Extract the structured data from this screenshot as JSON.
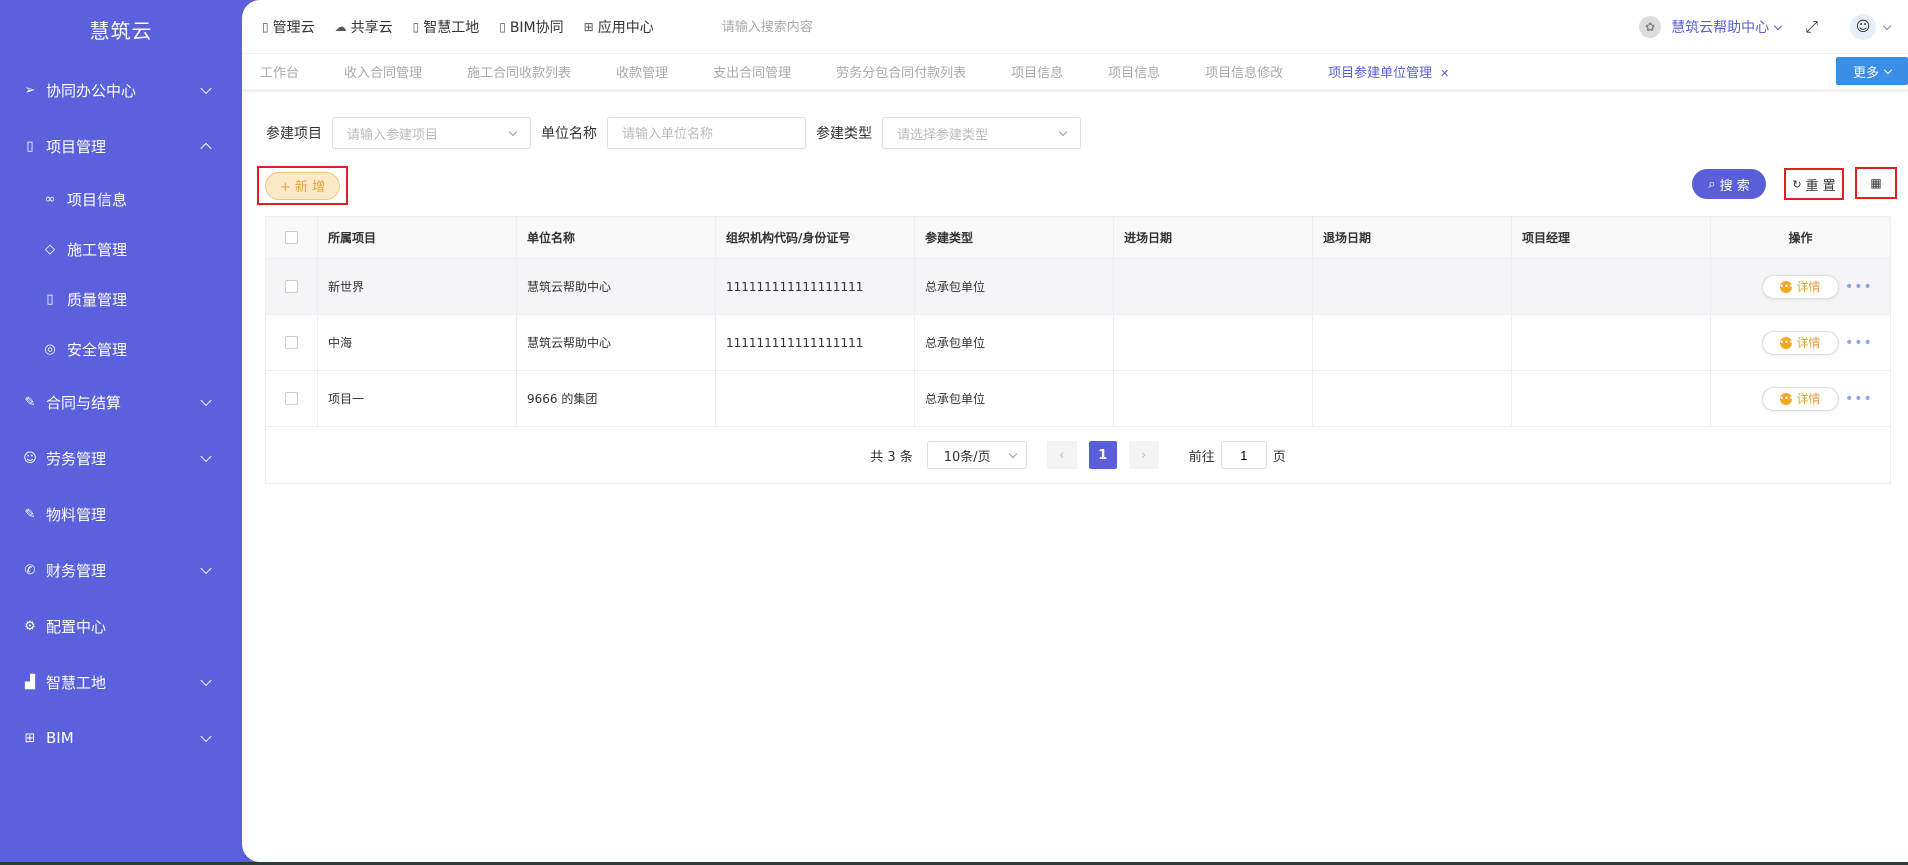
{
  "app": {
    "name": "慧筑云"
  },
  "sidebar": {
    "items": [
      {
        "label": "协同办公中心",
        "icon": "send-icon"
      },
      {
        "label": "项目管理",
        "icon": "book-icon"
      },
      {
        "label": "合同与结算",
        "icon": "edit-icon"
      },
      {
        "label": "劳务管理",
        "icon": "user-group-icon"
      },
      {
        "label": "物料管理",
        "icon": "edit-icon"
      },
      {
        "label": "财务管理",
        "icon": "phone-icon"
      },
      {
        "label": "配置中心",
        "icon": "gear-icon"
      },
      {
        "label": "智慧工地",
        "icon": "bar-chart-icon"
      },
      {
        "label": "BIM",
        "icon": "grid-icon"
      }
    ],
    "sub_items": [
      {
        "label": "项目信息",
        "icon": "glasses-icon"
      },
      {
        "label": "施工管理",
        "icon": "tag-icon"
      },
      {
        "label": "质量管理",
        "icon": "book-icon"
      },
      {
        "label": "安全管理",
        "icon": "location-icon"
      }
    ]
  },
  "topnav": {
    "items": [
      {
        "label": "管理云",
        "icon": "doc-icon"
      },
      {
        "label": "共享云",
        "icon": "cloud-icon"
      },
      {
        "label": "智慧工地",
        "icon": "doc-icon"
      },
      {
        "label": "BIM协同",
        "icon": "doc-icon"
      },
      {
        "label": "应用中心",
        "icon": "grid-icon"
      }
    ],
    "search_placeholder": "请输入搜索内容",
    "help_label": "慧筑云帮助中心"
  },
  "tabs": {
    "items": [
      "工作台",
      "收入合同管理",
      "施工合同收款列表",
      "收款管理",
      "支出合同管理",
      "劳务分包合同付款列表",
      "项目信息",
      "项目信息",
      "项目信息修改"
    ],
    "active": "项目参建单位管理",
    "more_label": "更多"
  },
  "filters": {
    "project_label": "参建项目",
    "project_placeholder": "请输入参建项目",
    "unit_label": "单位名称",
    "unit_placeholder": "请输入单位名称",
    "type_label": "参建类型",
    "type_placeholder": "请选择参建类型"
  },
  "actions": {
    "add_label": "+ 新 增",
    "search_label": "搜 索",
    "reset_label": "重 置"
  },
  "table": {
    "columns": [
      "所属项目",
      "单位名称",
      "组织机构代码/身份证号",
      "参建类型",
      "进场日期",
      "退场日期",
      "项目经理",
      "操作"
    ],
    "rows": [
      {
        "project": "新世界",
        "unit": "慧筑云帮助中心",
        "code": "111111111111111111",
        "type": "总承包单位",
        "entry": "",
        "exit": "",
        "manager": ""
      },
      {
        "project": "中海",
        "unit": "慧筑云帮助中心",
        "code": "111111111111111111",
        "type": "总承包单位",
        "entry": "",
        "exit": "",
        "manager": ""
      },
      {
        "project": "项目一",
        "unit": "9666 的集团",
        "code": "",
        "type": "总承包单位",
        "entry": "",
        "exit": "",
        "manager": ""
      }
    ],
    "detail_label": "详情",
    "more_dots": "•••"
  },
  "pagination": {
    "total_text": "共 3 条",
    "page_size": "10条/页",
    "current_page": "1",
    "goto_prefix": "前往",
    "goto_value": "1",
    "goto_suffix": "页"
  },
  "colors": {
    "primary": "#5a5fd8",
    "warning": "#e6a23c",
    "highlight_border": "#e02020"
  }
}
